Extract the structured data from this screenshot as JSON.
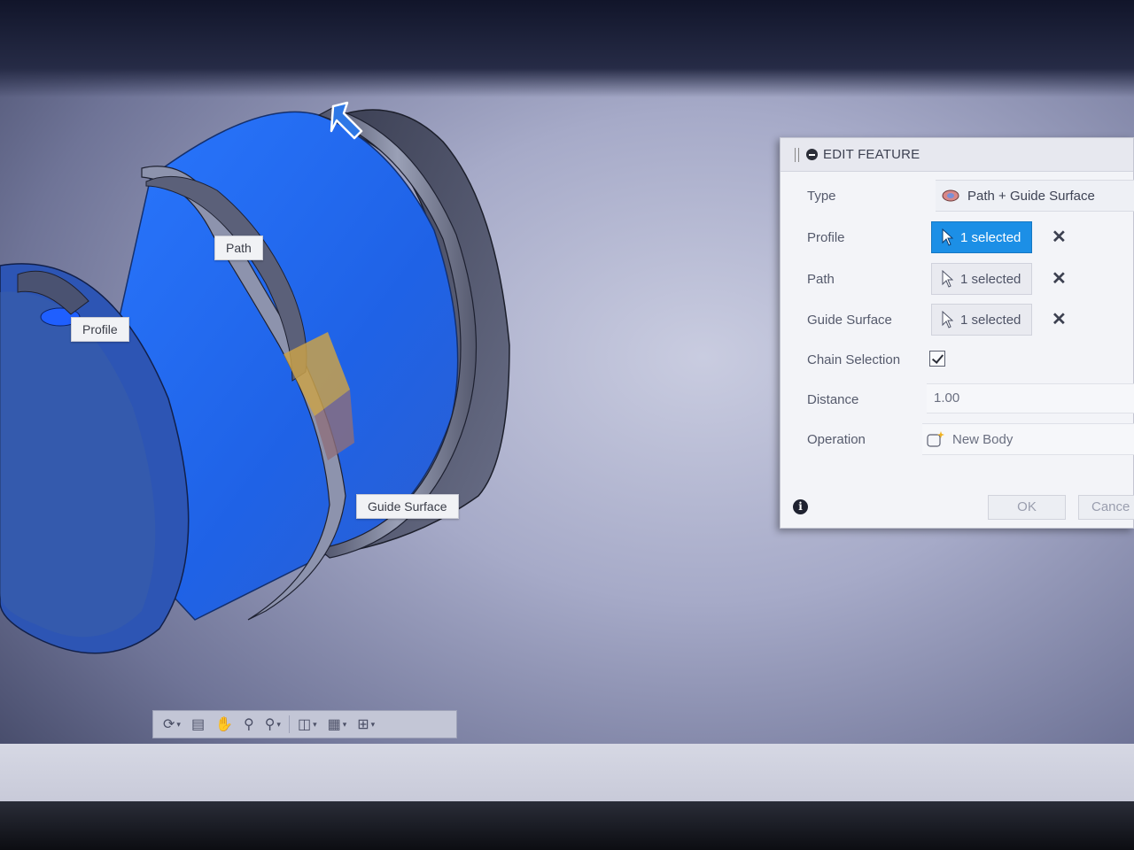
{
  "viewport": {
    "callouts": {
      "profile": "Profile",
      "path": "Path",
      "guide_surface": "Guide Surface"
    }
  },
  "nav_toolbar": {
    "icons": [
      "orbit-icon",
      "look-at-icon",
      "pan-icon",
      "zoom-window-icon",
      "zoom-icon",
      "display-settings-icon",
      "grid-icon",
      "viewports-icon"
    ]
  },
  "dialog": {
    "title": "EDIT FEATURE",
    "rows": {
      "type": {
        "label": "Type",
        "value": "Path + Guide Surface"
      },
      "profile": {
        "label": "Profile",
        "value": "1 selected"
      },
      "path": {
        "label": "Path",
        "value": "1 selected"
      },
      "guide_surface": {
        "label": "Guide Surface",
        "value": "1 selected"
      },
      "chain_selection": {
        "label": "Chain Selection",
        "checked": true
      },
      "distance": {
        "label": "Distance",
        "value": "1.00"
      },
      "operation": {
        "label": "Operation",
        "value": "New Body"
      }
    },
    "info_glyph": "i",
    "ok_label": "OK",
    "cancel_label": "Cance"
  },
  "colors": {
    "selection_blue": "#1c6df0",
    "active_button": "#1c8fe6",
    "dialog_bg": "#f3f4f8"
  }
}
